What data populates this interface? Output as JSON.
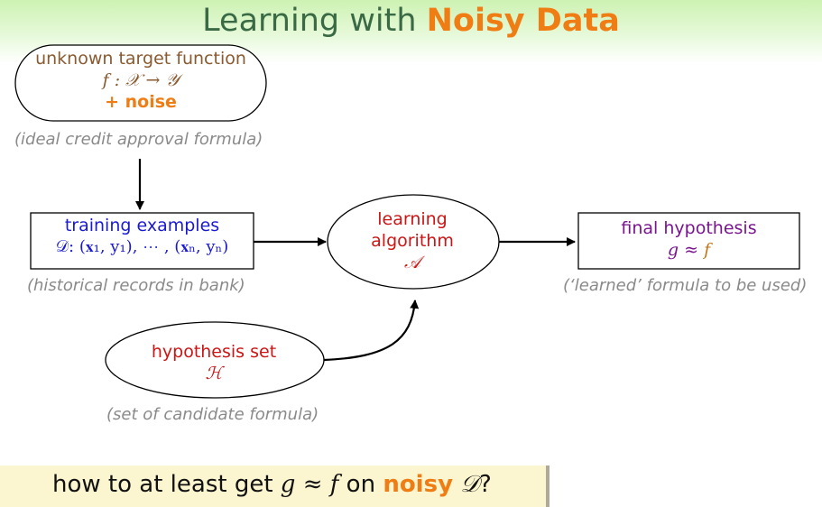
{
  "title": {
    "prefix": "Learning with ",
    "highlight": "Noisy Data"
  },
  "target": {
    "label": "unknown target function",
    "formula": "f : 𝒳 → 𝒴",
    "noise": "+ noise",
    "caption": "(ideal credit approval formula)"
  },
  "training": {
    "label": "training examples",
    "formula": "𝒟: (𝐱₁, y₁), ⋯ , (𝐱ₙ, yₙ)",
    "caption": "(historical records in bank)"
  },
  "algorithm": {
    "line1": "learning",
    "line2": "algorithm",
    "symbol": "𝒜"
  },
  "final": {
    "label": "final hypothesis",
    "g": "g ≈",
    "f": "f",
    "caption": "(‘learned’ formula to be used)"
  },
  "hypothesis": {
    "label": "hypothesis set",
    "symbol": "ℋ",
    "caption": "(set of candidate formula)"
  },
  "question": {
    "part1": "how to at least get ",
    "math1": "g ≈ f",
    "part2": " on ",
    "highlight": "noisy",
    "math2": " 𝒟",
    "part3": "?"
  },
  "colors": {
    "title": "#3a6a45",
    "accent": "#f07c14",
    "training": "#1a1ad2",
    "algorithm": "#cc1515",
    "final": "#7a1590",
    "caption": "#8a8a8a"
  }
}
